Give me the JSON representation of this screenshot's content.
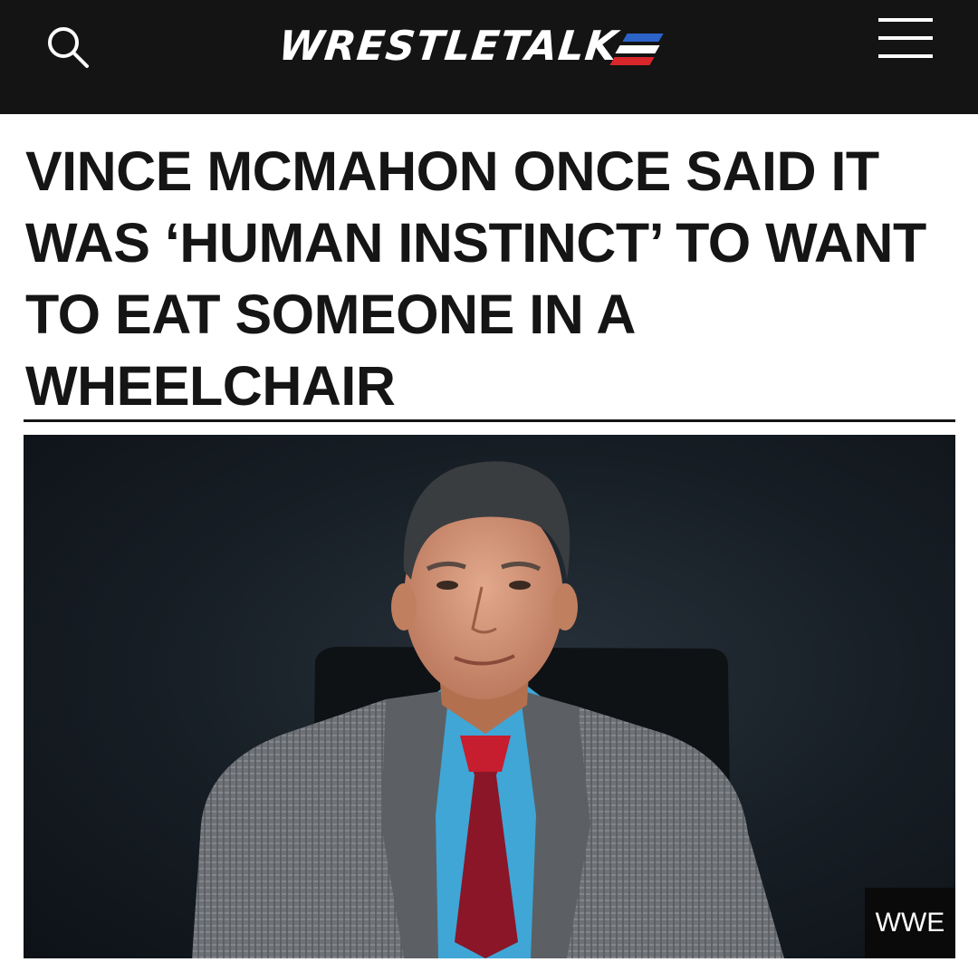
{
  "header": {
    "logo_text": "WRESTLETALK",
    "logo_stripe_colors": [
      "#2b63c9",
      "#ffffff",
      "#d8262b"
    ],
    "search_icon": "search-icon",
    "menu_icon": "hamburger-menu-icon"
  },
  "article": {
    "headline": "VINCE MCMAHON ONCE SAID IT WAS ‘HUMAN INSTINCT’ TO WANT TO EAT SOMEONE IN A WHEELCHAIR",
    "image_credit": "WWE"
  },
  "colors": {
    "header_background": "#141414",
    "text": "#151515",
    "page_background": "#ffffff"
  }
}
